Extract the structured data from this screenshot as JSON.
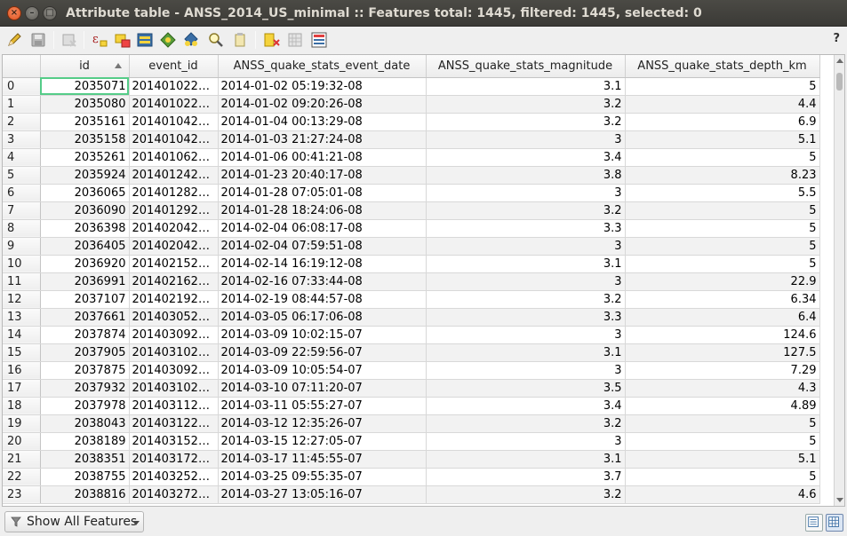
{
  "window": {
    "title": "Attribute table - ANSS_2014_US_minimal :: Features total: 1445, filtered: 1445, selected: 0",
    "close_glyph": "×",
    "minimize_glyph": "–",
    "maximize_glyph": "□"
  },
  "toolbar": {
    "help_label": "?",
    "icons": [
      "edit-pencil-icon",
      "save-edits-icon",
      "delete-selected-icon",
      "expression-select-icon",
      "select-all-icon",
      "invert-selection-icon",
      "deselect-icon",
      "move-selection-to-top-icon",
      "pan-to-selected-icon",
      "zoom-to-selected-icon",
      "copy-selected-icon",
      "delete-column-icon",
      "new-column-icon",
      "field-calculator-icon"
    ]
  },
  "table": {
    "columns": [
      "id",
      "event_id",
      "ANSS_quake_stats_event_date",
      "ANSS_quake_stats_magnitude",
      "ANSS_quake_stats_depth_km"
    ],
    "sort_column": "id",
    "sort_direction": "ascending",
    "rows": [
      {
        "n": "0",
        "id": "2035071",
        "event_id": "201401022…",
        "date": "2014-01-02 05:19:32-08",
        "mag": "3.1",
        "depth": "5"
      },
      {
        "n": "1",
        "id": "2035080",
        "event_id": "201401022…",
        "date": "2014-01-02 09:20:26-08",
        "mag": "3.2",
        "depth": "4.4"
      },
      {
        "n": "2",
        "id": "2035161",
        "event_id": "201401042…",
        "date": "2014-01-04 00:13:29-08",
        "mag": "3.2",
        "depth": "6.9"
      },
      {
        "n": "3",
        "id": "2035158",
        "event_id": "201401042…",
        "date": "2014-01-03 21:27:24-08",
        "mag": "3",
        "depth": "5.1"
      },
      {
        "n": "4",
        "id": "2035261",
        "event_id": "201401062…",
        "date": "2014-01-06 00:41:21-08",
        "mag": "3.4",
        "depth": "5"
      },
      {
        "n": "5",
        "id": "2035924",
        "event_id": "201401242…",
        "date": "2014-01-23 20:40:17-08",
        "mag": "3.8",
        "depth": "8.23"
      },
      {
        "n": "6",
        "id": "2036065",
        "event_id": "201401282…",
        "date": "2014-01-28 07:05:01-08",
        "mag": "3",
        "depth": "5.5"
      },
      {
        "n": "7",
        "id": "2036090",
        "event_id": "201401292…",
        "date": "2014-01-28 18:24:06-08",
        "mag": "3.2",
        "depth": "5"
      },
      {
        "n": "8",
        "id": "2036398",
        "event_id": "201402042…",
        "date": "2014-02-04 06:08:17-08",
        "mag": "3.3",
        "depth": "5"
      },
      {
        "n": "9",
        "id": "2036405",
        "event_id": "201402042…",
        "date": "2014-02-04 07:59:51-08",
        "mag": "3",
        "depth": "5"
      },
      {
        "n": "10",
        "id": "2036920",
        "event_id": "201402152…",
        "date": "2014-02-14 16:19:12-08",
        "mag": "3.1",
        "depth": "5"
      },
      {
        "n": "11",
        "id": "2036991",
        "event_id": "201402162…",
        "date": "2014-02-16 07:33:44-08",
        "mag": "3",
        "depth": "22.9"
      },
      {
        "n": "12",
        "id": "2037107",
        "event_id": "201402192…",
        "date": "2014-02-19 08:44:57-08",
        "mag": "3.2",
        "depth": "6.34"
      },
      {
        "n": "13",
        "id": "2037661",
        "event_id": "201403052…",
        "date": "2014-03-05 06:17:06-08",
        "mag": "3.3",
        "depth": "6.4"
      },
      {
        "n": "14",
        "id": "2037874",
        "event_id": "201403092…",
        "date": "2014-03-09 10:02:15-07",
        "mag": "3",
        "depth": "124.6"
      },
      {
        "n": "15",
        "id": "2037905",
        "event_id": "201403102…",
        "date": "2014-03-09 22:59:56-07",
        "mag": "3.1",
        "depth": "127.5"
      },
      {
        "n": "16",
        "id": "2037875",
        "event_id": "201403092…",
        "date": "2014-03-09 10:05:54-07",
        "mag": "3",
        "depth": "7.29"
      },
      {
        "n": "17",
        "id": "2037932",
        "event_id": "201403102…",
        "date": "2014-03-10 07:11:20-07",
        "mag": "3.5",
        "depth": "4.3"
      },
      {
        "n": "18",
        "id": "2037978",
        "event_id": "201403112…",
        "date": "2014-03-11 05:55:27-07",
        "mag": "3.4",
        "depth": "4.89"
      },
      {
        "n": "19",
        "id": "2038043",
        "event_id": "201403122…",
        "date": "2014-03-12 12:35:26-07",
        "mag": "3.2",
        "depth": "5"
      },
      {
        "n": "20",
        "id": "2038189",
        "event_id": "201403152…",
        "date": "2014-03-15 12:27:05-07",
        "mag": "3",
        "depth": "5"
      },
      {
        "n": "21",
        "id": "2038351",
        "event_id": "201403172…",
        "date": "2014-03-17 11:45:55-07",
        "mag": "3.1",
        "depth": "5.1"
      },
      {
        "n": "22",
        "id": "2038755",
        "event_id": "201403252…",
        "date": "2014-03-25 09:55:35-07",
        "mag": "3.7",
        "depth": "5"
      },
      {
        "n": "23",
        "id": "2038816",
        "event_id": "201403272…",
        "date": "2014-03-27 13:05:16-07",
        "mag": "3.2",
        "depth": "4.6"
      }
    ]
  },
  "bottom": {
    "filter_label": "Show All Features",
    "view_modes": [
      "form-view-icon",
      "table-view-icon"
    ],
    "active_view": "table-view-icon"
  },
  "colors": {
    "titlebar": "#3b3a36",
    "title_text": "#dfdbd2",
    "current_cell_outline": "#55cc88",
    "close_button": "#e0531f"
  }
}
